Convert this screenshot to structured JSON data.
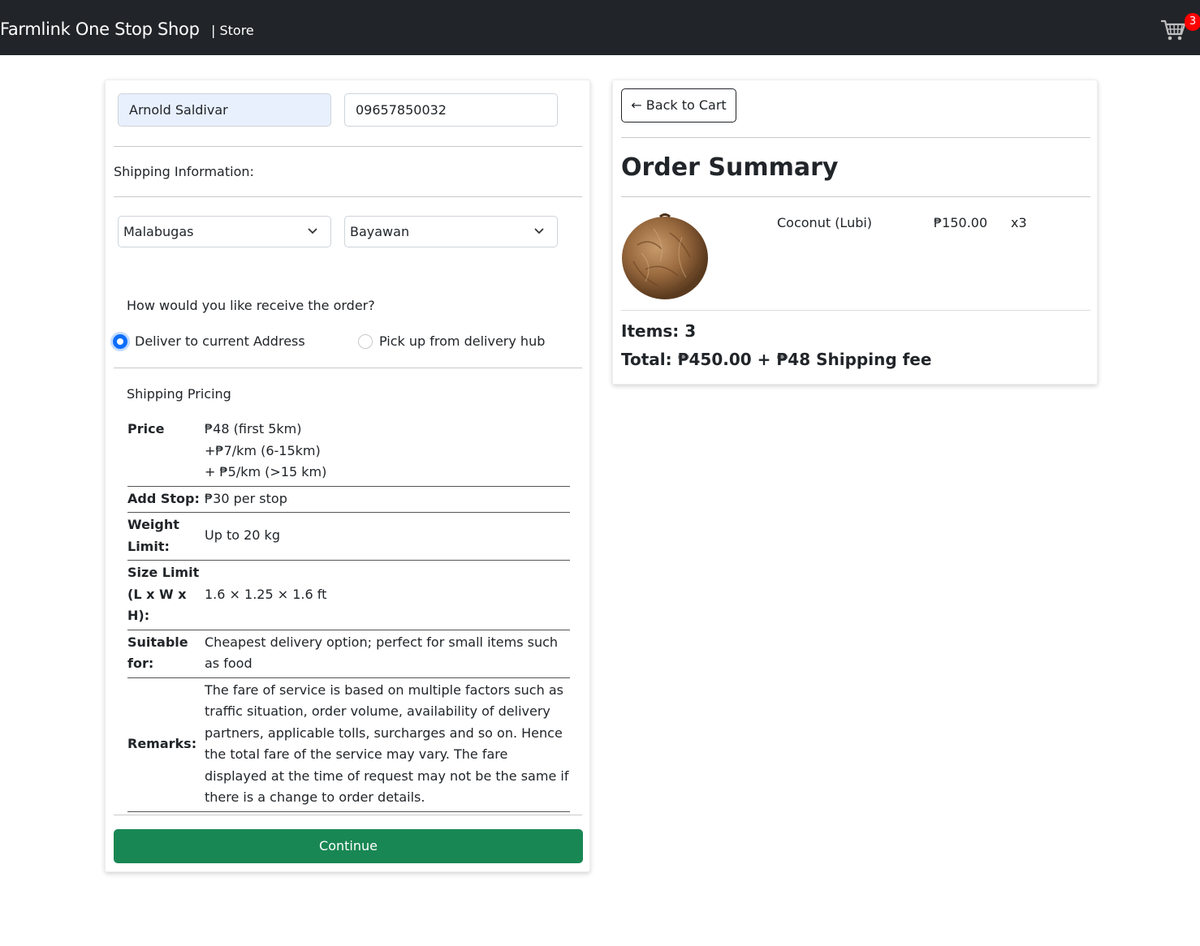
{
  "navbar": {
    "brand": "Farmlink One Stop Shop",
    "store_link": "| Store",
    "cart_icon": "shopping-cart-icon",
    "cart_count": "3",
    "background": "#212529"
  },
  "checkout_form": {
    "name_value": "Arnold Saldivar",
    "phone_value": "09657850032",
    "shipping_info_label": "Shipping Information:",
    "barangay_select": "Malabugas",
    "city_select": "Bayawan",
    "receive_question": "How would you like receive the order?",
    "radio_options": [
      {
        "label": "Deliver to current Address",
        "checked": true
      },
      {
        "label": "Pick up from delivery hub",
        "checked": false
      }
    ],
    "pricing_heading": "Shipping Pricing",
    "pricing_rows": [
      {
        "label": "Price",
        "lines": [
          "₱48 (first 5km)",
          "+₱7/km (6-15km)",
          "+ ₱5/km (>15 km)"
        ]
      },
      {
        "label": "Add Stop:",
        "lines": [
          "₱30 per stop"
        ]
      },
      {
        "label": "Weight Limit:",
        "lines": [
          "Up to 20 kg"
        ]
      },
      {
        "label": "Size Limit (L x W x H):",
        "lines": [
          "1.6 × 1.25 × 1.6 ft"
        ]
      },
      {
        "label": "Suitable for:",
        "lines": [
          "Cheapest delivery option; perfect for small items such as food"
        ]
      },
      {
        "label": "Remarks:",
        "lines": [
          "The fare of service is based on multiple factors such as traffic situation, order volume, availability of delivery partners, applicable tolls, surcharges and so on. Hence the total fare of the service may vary. The fare displayed at the time of request may not be the same if there is a change to order details."
        ]
      }
    ],
    "continue_label": "Continue",
    "accent_color": "#198754"
  },
  "order_summary": {
    "back_label": "← Back to Cart",
    "title": "Order Summary",
    "item": {
      "name": "Coconut (Lubi)",
      "price": "₱150.00",
      "quantity": "x3",
      "image_icon": "coconut-image"
    },
    "items_total": "Items: 3",
    "total": "Total: ₱450.00 + ₱48 Shipping fee"
  }
}
